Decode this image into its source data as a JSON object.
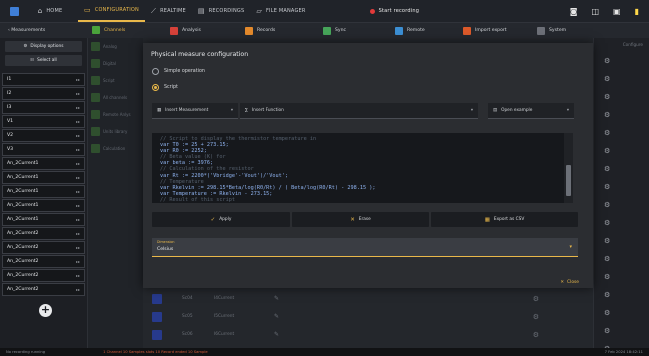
{
  "topnav": {
    "home": "HOME",
    "configuration": "CONFIGURATION",
    "realtime": "REALTIME",
    "recordings": "RECORDINGS",
    "file_manager": "FILE MANAGER",
    "start_recording": "Start recording"
  },
  "subnav": {
    "back": "‹  Measurements",
    "items": [
      {
        "label": "Channels",
        "color": "#4aa33b"
      },
      {
        "label": "Analysis",
        "color": "#d7423a"
      },
      {
        "label": "Records",
        "color": "#e48a2c"
      },
      {
        "label": "Sync",
        "color": "#47a55a"
      },
      {
        "label": "Remote",
        "color": "#3c8fd4"
      },
      {
        "label": "Import export",
        "color": "#dd5a2a"
      },
      {
        "label": "System",
        "color": "#6d7078"
      }
    ]
  },
  "left": {
    "display_options": "Display options",
    "select_all": "Select all",
    "channels": [
      "I1",
      "I2",
      "I3",
      "V1",
      "V2",
      "V3",
      "An_2Current1",
      "An_2Current1",
      "An_2Current1",
      "An_2Current1",
      "An_2Current1",
      "An_2Current2",
      "An_2Current2",
      "An_2Current2",
      "An_2Current2",
      "An_2Current2"
    ],
    "channel_action": "▸▸"
  },
  "middle": {
    "items": [
      "Analog",
      "Digital",
      "Script",
      "All channels",
      "Remote Anlys",
      "Units library",
      "Calculation"
    ]
  },
  "background_rows": [
    {
      "name": "Sc04",
      "value": "I4Current"
    },
    {
      "name": "Sc05",
      "value": "I5Current"
    },
    {
      "name": "Sc06",
      "value": "I6Current"
    }
  ],
  "right": {
    "header": "Configure"
  },
  "modal": {
    "title": "Physical measure configuration",
    "option_simple": "Simple operation",
    "option_script": "Script",
    "insert_measurement": "Insert Measurement",
    "insert_function": "Insert Function",
    "open_example": "Open example",
    "code_lines": [
      {
        "t": "cm",
        "s": "// Script to display the thermistor temperature in"
      },
      {
        "t": "kw",
        "s": "var T0 := 25 + 273.15;"
      },
      {
        "t": "kw",
        "s": "var R0 := 2252;"
      },
      {
        "t": "cm",
        "s": "// Beta value (K) for"
      },
      {
        "t": "kw",
        "s": "var beta := 3976;"
      },
      {
        "t": "cm",
        "s": "// Calculation of the resistor"
      },
      {
        "t": "kw",
        "s": "var Rt := 2200*('Vbridge'-'Vout')/'Vout';"
      },
      {
        "t": "cm",
        "s": "// Temperature"
      },
      {
        "t": "kw",
        "s": "var Rkelvin := 298.15*Beta/log(R0/Rt) / ( Beta/log(R0/Rt) - 298.15 );"
      },
      {
        "t": "kw",
        "s": "var Temperature := Rkelvin - 273.15;"
      },
      {
        "t": "cm",
        "s": "// Result of this script"
      }
    ],
    "apply": "Apply",
    "erase": "Erase",
    "export_csv": "Export as CSV",
    "dimension_label": "Dimension",
    "dimension_value": "Celsius",
    "close": "Close"
  },
  "status": {
    "left": "No recording running",
    "middle": "1 Channel 10 Samples slots 10 Record ended 10 Sample",
    "right": "7 Feb 2024 18:42:11"
  }
}
